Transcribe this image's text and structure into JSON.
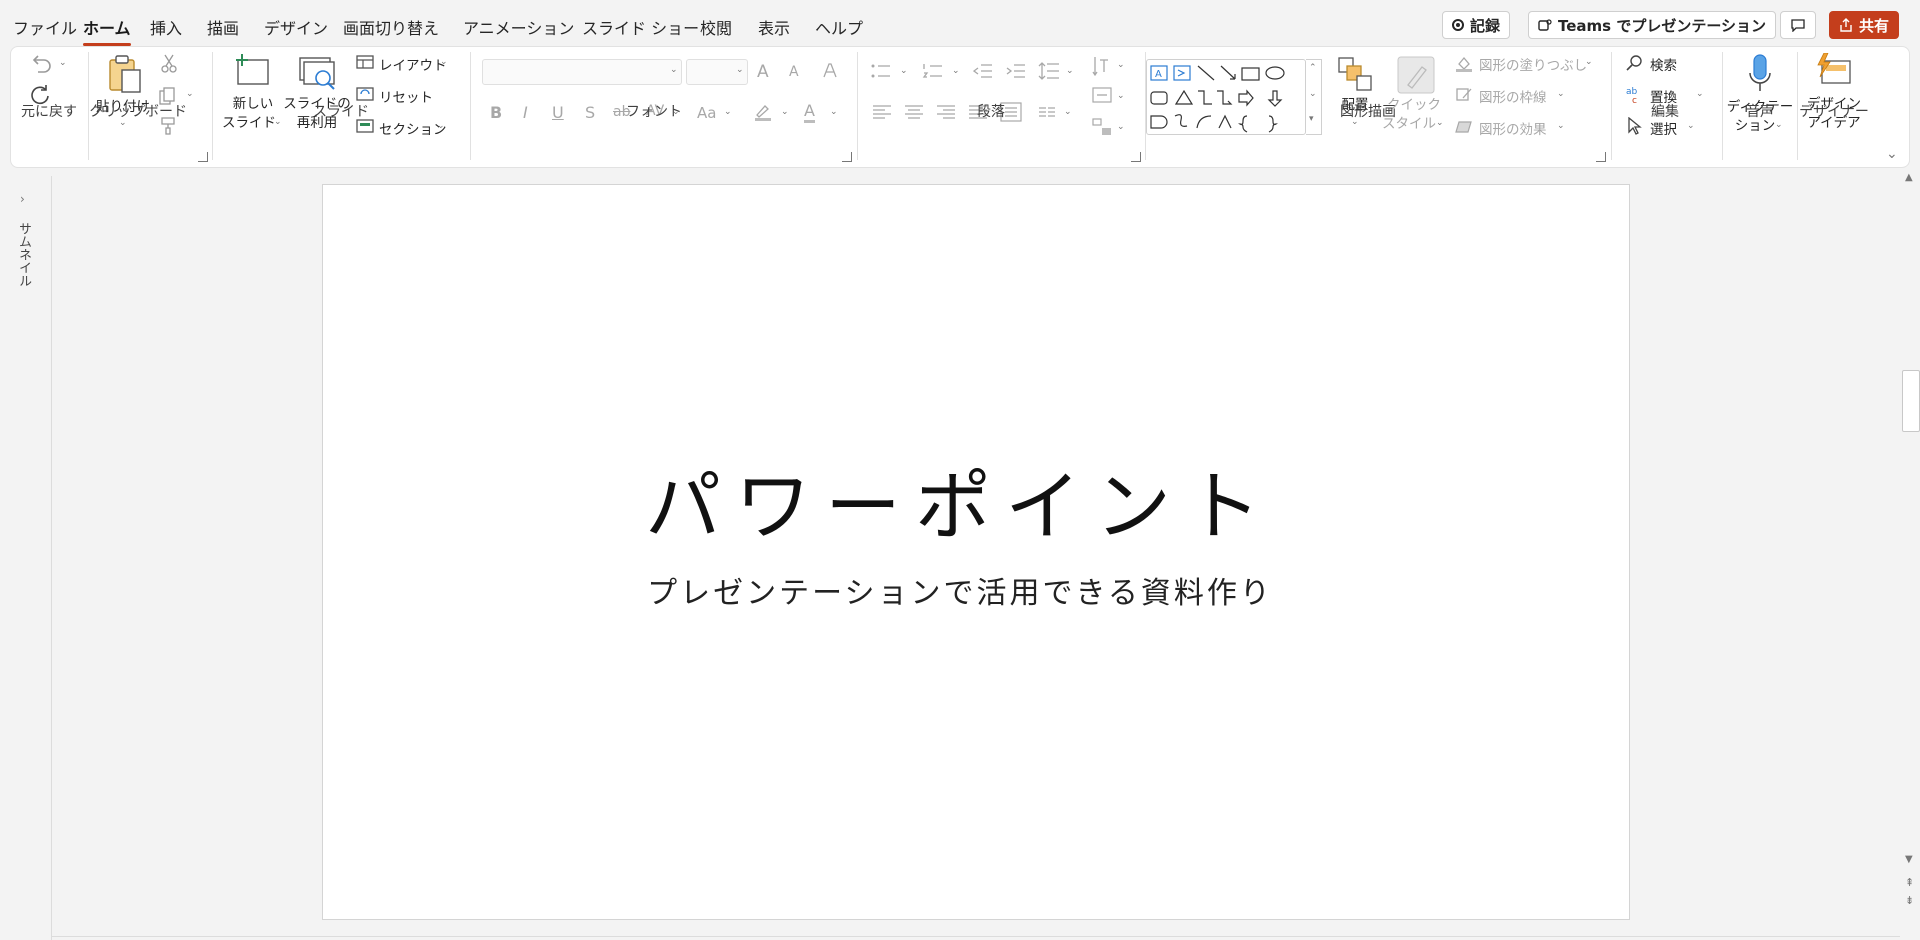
{
  "menu": {
    "tabs": [
      "ファイル",
      "ホーム",
      "挿入",
      "描画",
      "デザイン",
      "画面切り替え",
      "アニメーション",
      "スライド ショー",
      "校閲",
      "表示",
      "ヘルプ"
    ],
    "active_tab": "ホーム",
    "record_label": "記録",
    "teams_label": "Teams でプレゼンテーション",
    "share_label": "共有"
  },
  "ribbon": {
    "groups": {
      "undo": "元に戻す",
      "clipboard": "クリップボード",
      "slides": "スライド",
      "font": "フォント",
      "paragraph": "段落",
      "drawing": "図形描画",
      "editing": "編集",
      "voice": "音声",
      "designer": "デザイナー"
    },
    "paste_label": "貼り付け",
    "new_slide_l1": "新しい",
    "new_slide_l2": "スライド",
    "reuse_l1": "スライドの",
    "reuse_l2": "再利用",
    "layout_label": "レイアウト",
    "reset_label": "リセット",
    "section_label": "セクション",
    "arrange_label": "配置",
    "quick_style_l1": "クイック",
    "quick_style_l2": "スタイル",
    "shape_fill": "図形の塗りつぶし",
    "shape_outline": "図形の枠線",
    "shape_effects": "図形の効果",
    "find_label": "検索",
    "replace_label": "置換",
    "select_label": "選択",
    "dictate_l1": "ディクテー",
    "dictate_l2": "ション",
    "design_l1": "デザイン",
    "design_l2": "アイデア",
    "font_buttons": {
      "bold": "B",
      "italic": "I",
      "underline": "U",
      "shadow": "S",
      "strike": "ab",
      "spacing": "AV",
      "case": "Aa",
      "font_color": "A",
      "grow": "A",
      "shrink": "A"
    }
  },
  "thumbnail_pane_label": "サムネイル",
  "slide": {
    "title": "パワーポイント",
    "subtitle": "プレゼンテーションで活用できる資料作り"
  },
  "colors": {
    "accent": "#c43e1c"
  }
}
